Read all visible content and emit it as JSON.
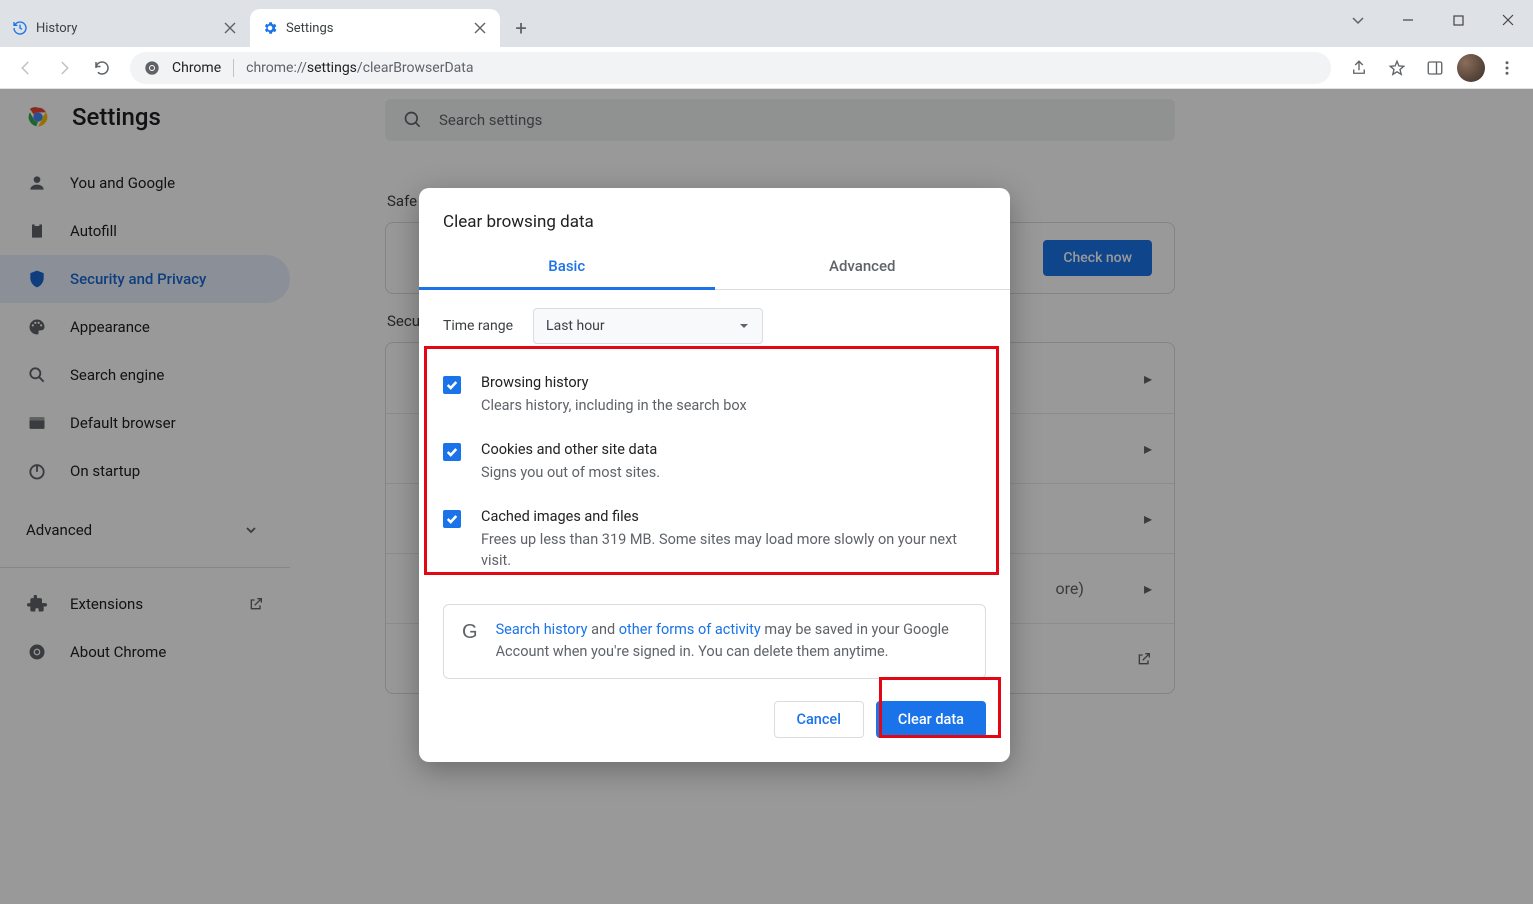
{
  "tabs": [
    {
      "title": "History"
    },
    {
      "title": "Settings"
    }
  ],
  "omnibox": {
    "product": "Chrome",
    "url_pre": "chrome://",
    "url_mid": "settings",
    "url_post": "/clearBrowserData"
  },
  "settings": {
    "title": "Settings",
    "search_placeholder": "Search settings",
    "sidebar": [
      "You and Google",
      "Autofill",
      "Security and Privacy",
      "Appearance",
      "Search engine",
      "Default browser",
      "On startup"
    ],
    "advanced": "Advanced",
    "extensions": "Extensions",
    "about": "About Chrome",
    "section_safe": "Safe",
    "section_sec": "Secu",
    "check_now": "Check now",
    "more_suffix": "ore)"
  },
  "dialog": {
    "title": "Clear browsing data",
    "tab_basic": "Basic",
    "tab_advanced": "Advanced",
    "time_range_label": "Time range",
    "time_range_value": "Last hour",
    "items": [
      {
        "title": "Browsing history",
        "desc": "Clears history, including in the search box"
      },
      {
        "title": "Cookies and other site data",
        "desc": "Signs you out of most sites."
      },
      {
        "title": "Cached images and files",
        "desc": "Frees up less than 319 MB. Some sites may load more slowly on your next visit."
      }
    ],
    "notice_link1": "Search history",
    "notice_mid": " and ",
    "notice_link2": "other forms of activity",
    "notice_tail": " may be saved in your Google Account when you're signed in. You can delete them anytime.",
    "cancel": "Cancel",
    "clear": "Clear data"
  }
}
